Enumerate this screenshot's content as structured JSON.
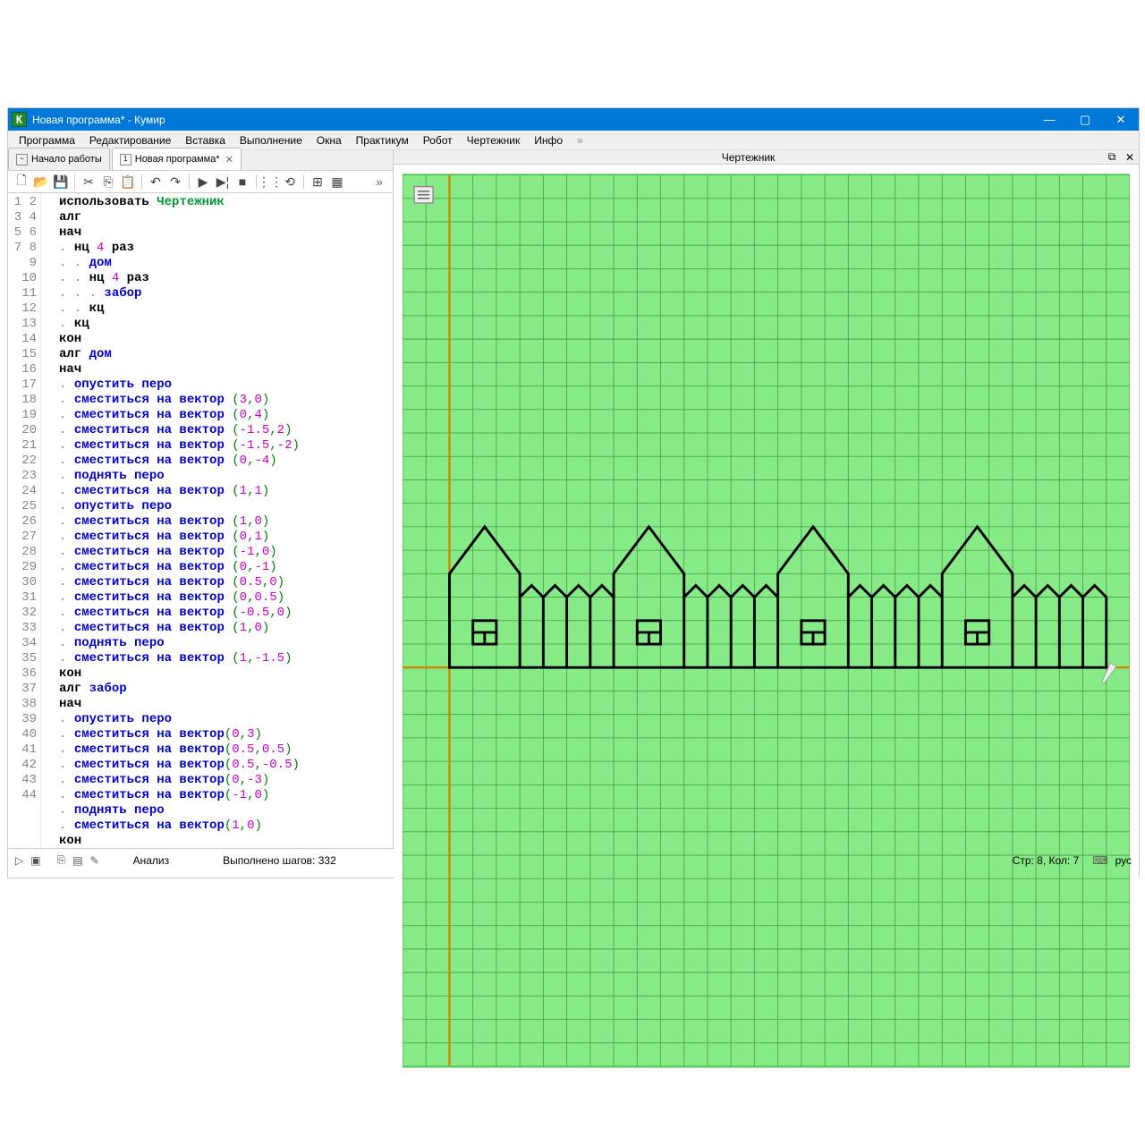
{
  "window": {
    "title": "Новая программа* - Кумир"
  },
  "menus": [
    "Программа",
    "Редактирование",
    "Вставка",
    "Выполнение",
    "Окна",
    "Практикум",
    "Робот",
    "Чертежник",
    "Инфо"
  ],
  "tabs": [
    {
      "icon": "~",
      "label": "Начало работы",
      "active": false,
      "closeable": false
    },
    {
      "icon": "1",
      "label": "Новая программа*",
      "active": true,
      "closeable": true
    }
  ],
  "panel": {
    "title": "Чертежник"
  },
  "status": {
    "analysis": "Анализ",
    "steps": "Выполнено шагов: 332",
    "pos": "Стр: 8, Кол: 7",
    "lang": "рус"
  },
  "code": [
    {
      "n": 1,
      "t": [
        [
          "kw",
          "использовать "
        ],
        [
          "lib",
          "Чертежник"
        ]
      ]
    },
    {
      "n": 2,
      "t": [
        [
          "kw",
          "алг"
        ]
      ]
    },
    {
      "n": 3,
      "t": [
        [
          "kw",
          "нач"
        ]
      ]
    },
    {
      "n": 4,
      "t": [
        [
          "dot",
          ". "
        ],
        [
          "kw",
          "нц "
        ],
        [
          "num",
          "4"
        ],
        [
          "kw",
          " раз"
        ]
      ]
    },
    {
      "n": 5,
      "t": [
        [
          "dot",
          ". . "
        ],
        [
          "cmd",
          "дом"
        ]
      ]
    },
    {
      "n": 6,
      "t": [
        [
          "dot",
          ". . "
        ],
        [
          "kw",
          "нц "
        ],
        [
          "num",
          "4"
        ],
        [
          "kw",
          " раз"
        ]
      ]
    },
    {
      "n": 7,
      "t": [
        [
          "dot",
          ". . . "
        ],
        [
          "cmd",
          "забор"
        ]
      ]
    },
    {
      "n": 8,
      "t": [
        [
          "dot",
          ". . "
        ],
        [
          "kw",
          "кц"
        ]
      ]
    },
    {
      "n": 9,
      "t": [
        [
          "dot",
          ". "
        ],
        [
          "kw",
          "кц"
        ]
      ]
    },
    {
      "n": 10,
      "t": [
        [
          "kw",
          "кон"
        ]
      ]
    },
    {
      "n": 11,
      "t": [
        [
          "kw",
          "алг "
        ],
        [
          "cmd",
          "дом"
        ]
      ]
    },
    {
      "n": 12,
      "t": [
        [
          "kw",
          "нач"
        ]
      ]
    },
    {
      "n": 13,
      "t": [
        [
          "dot",
          ". "
        ],
        [
          "cmd",
          "опустить перо"
        ]
      ]
    },
    {
      "n": 14,
      "t": [
        [
          "dot",
          ". "
        ],
        [
          "cmd",
          "сместиться на вектор "
        ],
        [
          "paren",
          "("
        ],
        [
          "num",
          "3"
        ],
        [
          "paren",
          ","
        ],
        [
          "num",
          "0"
        ],
        [
          "paren",
          ")"
        ]
      ]
    },
    {
      "n": 15,
      "t": [
        [
          "dot",
          ". "
        ],
        [
          "cmd",
          "сместиться на вектор "
        ],
        [
          "paren",
          "("
        ],
        [
          "num",
          "0"
        ],
        [
          "paren",
          ","
        ],
        [
          "num",
          "4"
        ],
        [
          "paren",
          ")"
        ]
      ]
    },
    {
      "n": 16,
      "t": [
        [
          "dot",
          ". "
        ],
        [
          "cmd",
          "сместиться на вектор "
        ],
        [
          "paren",
          "("
        ],
        [
          "num",
          "-1.5"
        ],
        [
          "paren",
          ","
        ],
        [
          "num",
          "2"
        ],
        [
          "paren",
          ")"
        ]
      ]
    },
    {
      "n": 17,
      "t": [
        [
          "dot",
          ". "
        ],
        [
          "cmd",
          "сместиться на вектор "
        ],
        [
          "paren",
          "("
        ],
        [
          "num",
          "-1.5"
        ],
        [
          "paren",
          ","
        ],
        [
          "num",
          "-2"
        ],
        [
          "paren",
          ")"
        ]
      ]
    },
    {
      "n": 18,
      "t": [
        [
          "dot",
          ". "
        ],
        [
          "cmd",
          "сместиться на вектор "
        ],
        [
          "paren",
          "("
        ],
        [
          "num",
          "0"
        ],
        [
          "paren",
          ","
        ],
        [
          "num",
          "-4"
        ],
        [
          "paren",
          ")"
        ]
      ]
    },
    {
      "n": 19,
      "t": [
        [
          "dot",
          ". "
        ],
        [
          "cmd",
          "поднять перо"
        ]
      ]
    },
    {
      "n": 20,
      "t": [
        [
          "dot",
          ". "
        ],
        [
          "cmd",
          "сместиться на вектор "
        ],
        [
          "paren",
          "("
        ],
        [
          "num",
          "1"
        ],
        [
          "paren",
          ","
        ],
        [
          "num",
          "1"
        ],
        [
          "paren",
          ")"
        ]
      ]
    },
    {
      "n": 21,
      "t": [
        [
          "dot",
          ". "
        ],
        [
          "cmd",
          "опустить перо"
        ]
      ]
    },
    {
      "n": 22,
      "t": [
        [
          "dot",
          ". "
        ],
        [
          "cmd",
          "сместиться на вектор "
        ],
        [
          "paren",
          "("
        ],
        [
          "num",
          "1"
        ],
        [
          "paren",
          ","
        ],
        [
          "num",
          "0"
        ],
        [
          "paren",
          ")"
        ]
      ]
    },
    {
      "n": 23,
      "t": [
        [
          "dot",
          ". "
        ],
        [
          "cmd",
          "сместиться на вектор "
        ],
        [
          "paren",
          "("
        ],
        [
          "num",
          "0"
        ],
        [
          "paren",
          ","
        ],
        [
          "num",
          "1"
        ],
        [
          "paren",
          ")"
        ]
      ]
    },
    {
      "n": 24,
      "t": [
        [
          "dot",
          ". "
        ],
        [
          "cmd",
          "сместиться на вектор "
        ],
        [
          "paren",
          "("
        ],
        [
          "num",
          "-1"
        ],
        [
          "paren",
          ","
        ],
        [
          "num",
          "0"
        ],
        [
          "paren",
          ")"
        ]
      ]
    },
    {
      "n": 25,
      "t": [
        [
          "dot",
          ". "
        ],
        [
          "cmd",
          "сместиться на вектор "
        ],
        [
          "paren",
          "("
        ],
        [
          "num",
          "0"
        ],
        [
          "paren",
          ","
        ],
        [
          "num",
          "-1"
        ],
        [
          "paren",
          ")"
        ]
      ]
    },
    {
      "n": 26,
      "t": [
        [
          "dot",
          ". "
        ],
        [
          "cmd",
          "сместиться на вектор "
        ],
        [
          "paren",
          "("
        ],
        [
          "num",
          "0.5"
        ],
        [
          "paren",
          ","
        ],
        [
          "num",
          "0"
        ],
        [
          "paren",
          ")"
        ]
      ]
    },
    {
      "n": 27,
      "t": [
        [
          "dot",
          ". "
        ],
        [
          "cmd",
          "сместиться на вектор "
        ],
        [
          "paren",
          "("
        ],
        [
          "num",
          "0"
        ],
        [
          "paren",
          ","
        ],
        [
          "num",
          "0.5"
        ],
        [
          "paren",
          ")"
        ]
      ]
    },
    {
      "n": 28,
      "t": [
        [
          "dot",
          ". "
        ],
        [
          "cmd",
          "сместиться на вектор "
        ],
        [
          "paren",
          "("
        ],
        [
          "num",
          "-0.5"
        ],
        [
          "paren",
          ","
        ],
        [
          "num",
          "0"
        ],
        [
          "paren",
          ")"
        ]
      ]
    },
    {
      "n": 29,
      "t": [
        [
          "dot",
          ". "
        ],
        [
          "cmd",
          "сместиться на вектор "
        ],
        [
          "paren",
          "("
        ],
        [
          "num",
          "1"
        ],
        [
          "paren",
          ","
        ],
        [
          "num",
          "0"
        ],
        [
          "paren",
          ")"
        ]
      ]
    },
    {
      "n": 30,
      "t": [
        [
          "dot",
          ". "
        ],
        [
          "cmd",
          "поднять перо"
        ]
      ]
    },
    {
      "n": 31,
      "t": [
        [
          "dot",
          ". "
        ],
        [
          "cmd",
          "сместиться на вектор "
        ],
        [
          "paren",
          "("
        ],
        [
          "num",
          "1"
        ],
        [
          "paren",
          ","
        ],
        [
          "num",
          "-1.5"
        ],
        [
          "paren",
          ")"
        ]
      ]
    },
    {
      "n": 32,
      "t": [
        [
          "kw",
          "кон"
        ]
      ]
    },
    {
      "n": 33,
      "t": [
        [
          "kw",
          "алг "
        ],
        [
          "cmd",
          "забор"
        ]
      ]
    },
    {
      "n": 34,
      "t": [
        [
          "kw",
          "нач"
        ]
      ]
    },
    {
      "n": 35,
      "t": [
        [
          "dot",
          ". "
        ],
        [
          "cmd",
          "опустить перо"
        ]
      ]
    },
    {
      "n": 36,
      "t": [
        [
          "dot",
          ". "
        ],
        [
          "cmd",
          "сместиться на вектор"
        ],
        [
          "paren",
          "("
        ],
        [
          "num",
          "0"
        ],
        [
          "paren",
          ","
        ],
        [
          "num",
          "3"
        ],
        [
          "paren",
          ")"
        ]
      ]
    },
    {
      "n": 37,
      "t": [
        [
          "dot",
          ". "
        ],
        [
          "cmd",
          "сместиться на вектор"
        ],
        [
          "paren",
          "("
        ],
        [
          "num",
          "0.5"
        ],
        [
          "paren",
          ","
        ],
        [
          "num",
          "0.5"
        ],
        [
          "paren",
          ")"
        ]
      ]
    },
    {
      "n": 38,
      "t": [
        [
          "dot",
          ". "
        ],
        [
          "cmd",
          "сместиться на вектор"
        ],
        [
          "paren",
          "("
        ],
        [
          "num",
          "0.5"
        ],
        [
          "paren",
          ","
        ],
        [
          "num",
          "-0.5"
        ],
        [
          "paren",
          ")"
        ]
      ]
    },
    {
      "n": 39,
      "t": [
        [
          "dot",
          ". "
        ],
        [
          "cmd",
          "сместиться на вектор"
        ],
        [
          "paren",
          "("
        ],
        [
          "num",
          "0"
        ],
        [
          "paren",
          ","
        ],
        [
          "num",
          "-3"
        ],
        [
          "paren",
          ")"
        ]
      ]
    },
    {
      "n": 40,
      "t": [
        [
          "dot",
          ". "
        ],
        [
          "cmd",
          "сместиться на вектор"
        ],
        [
          "paren",
          "("
        ],
        [
          "num",
          "-1"
        ],
        [
          "paren",
          ","
        ],
        [
          "num",
          "0"
        ],
        [
          "paren",
          ")"
        ]
      ]
    },
    {
      "n": 41,
      "t": [
        [
          "dot",
          ". "
        ],
        [
          "cmd",
          "поднять перо"
        ]
      ]
    },
    {
      "n": 42,
      "t": [
        [
          "dot",
          ". "
        ],
        [
          "cmd",
          "сместиться на вектор"
        ],
        [
          "paren",
          "("
        ],
        [
          "num",
          "1"
        ],
        [
          "paren",
          ","
        ],
        [
          "num",
          "0"
        ],
        [
          "paren",
          ")"
        ]
      ]
    },
    {
      "n": 43,
      "t": [
        [
          "kw",
          "кон"
        ]
      ]
    },
    {
      "n": 44,
      "t": []
    }
  ]
}
